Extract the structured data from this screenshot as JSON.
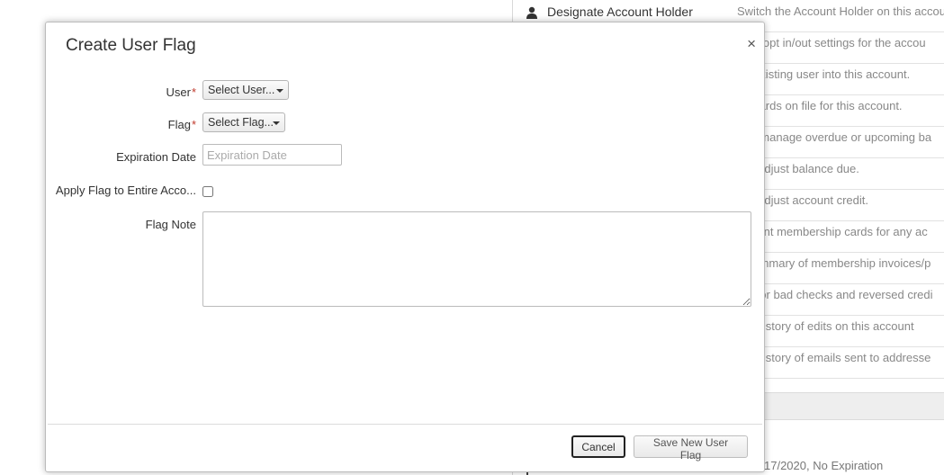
{
  "background": {
    "rows": [
      {
        "action": "Designate Account Holder",
        "description": "Switch the Account Holder on this account"
      },
      {
        "action": "",
        "description": "t the opt in/out settings for the accou"
      },
      {
        "action": "",
        "description": "an existing user into this account."
      },
      {
        "action": "",
        "description": "ge cards on file for this account."
      },
      {
        "action": "",
        "description": "and manage overdue or upcoming ba"
      },
      {
        "action": "",
        "description": "ally adjust balance due."
      },
      {
        "action": "",
        "description": "ally adjust account credit."
      },
      {
        "action": "",
        "description": "or print membership cards for any ac"
      },
      {
        "action": "",
        "description": "a summary of membership invoices/p"
      },
      {
        "action": "",
        "description": "unt for bad checks and reversed credi"
      },
      {
        "action": "",
        "description": "the history of edits on this account"
      },
      {
        "action": "",
        "description": "the history of emails sent to addresse"
      }
    ],
    "bottom_text": "17/2020, No Expiration"
  },
  "modal": {
    "title": "Create User Flag",
    "close_glyph": "×",
    "fields": {
      "user_label": "User",
      "user_value": "Select User...",
      "flag_label": "Flag",
      "flag_value": "Select Flag...",
      "expiration_label": "Expiration Date",
      "expiration_placeholder": "Expiration Date",
      "apply_label": "Apply Flag to Entire Acco...",
      "note_label": "Flag Note",
      "required_mark": "*"
    },
    "buttons": {
      "cancel": "Cancel",
      "save": "Save New User Flag"
    }
  }
}
